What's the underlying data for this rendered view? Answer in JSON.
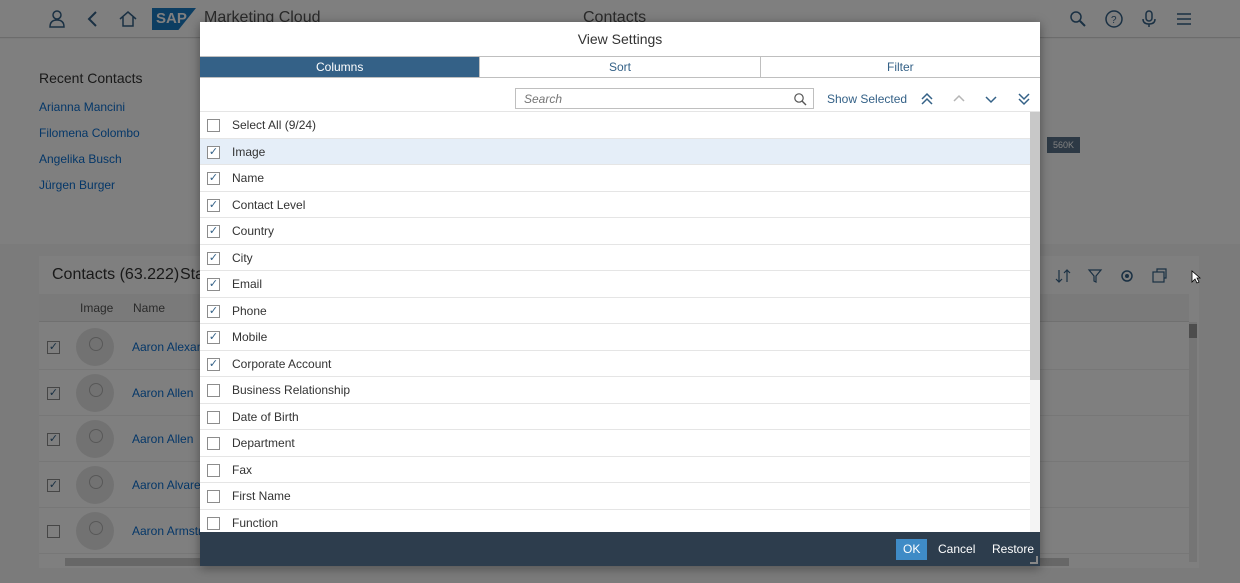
{
  "shell": {
    "logo_text": "SAP",
    "app_title": "Marketing Cloud",
    "center_title": "Contacts",
    "icons": [
      "user-icon",
      "back-icon",
      "home-icon",
      "search-icon",
      "help-icon",
      "microphone-icon",
      "menu-icon"
    ]
  },
  "recent_contacts": {
    "title": "Recent Contacts",
    "items": [
      "Arianna Mancini",
      "Filomena Colombo",
      "Angelika Busch",
      "Jürgen Burger"
    ],
    "badge": "560K"
  },
  "contacts_table": {
    "title": "Contacts (63.222)",
    "tab_partial": "Sta",
    "columns": [
      "Image",
      "Name"
    ],
    "rows": [
      {
        "name": "Aaron Alexan",
        "checked": true
      },
      {
        "name": "Aaron Allen",
        "checked": true
      },
      {
        "name": "Aaron Allen",
        "checked": true
      },
      {
        "name": "Aaron Alvarez",
        "checked": true
      },
      {
        "name": "Aaron Armstro",
        "checked": false
      }
    ]
  },
  "dialog": {
    "title": "View Settings",
    "tabs": [
      {
        "label": "Columns",
        "active": true
      },
      {
        "label": "Sort",
        "active": false
      },
      {
        "label": "Filter",
        "active": false
      }
    ],
    "search_placeholder": "Search",
    "show_selected_label": "Show Selected",
    "move_buttons": [
      "move-to-top-icon",
      "move-up-icon",
      "move-down-icon",
      "move-to-bottom-icon"
    ],
    "items": [
      {
        "label": "Select All (9/24)",
        "checked": false
      },
      {
        "label": "Image",
        "checked": true,
        "highlighted": true
      },
      {
        "label": "Name",
        "checked": true
      },
      {
        "label": "Contact Level",
        "checked": true
      },
      {
        "label": "Country",
        "checked": true
      },
      {
        "label": "City",
        "checked": true
      },
      {
        "label": "Email",
        "checked": true
      },
      {
        "label": "Phone",
        "checked": true
      },
      {
        "label": "Mobile",
        "checked": true
      },
      {
        "label": "Corporate Account",
        "checked": true
      },
      {
        "label": "Business Relationship",
        "checked": false
      },
      {
        "label": "Date of Birth",
        "checked": false
      },
      {
        "label": "Department",
        "checked": false
      },
      {
        "label": "Fax",
        "checked": false
      },
      {
        "label": "First Name",
        "checked": false
      },
      {
        "label": "Function",
        "checked": false
      }
    ],
    "footer": {
      "ok": "OK",
      "cancel": "Cancel",
      "restore": "Restore"
    }
  },
  "colors": {
    "accent": "#346187",
    "link": "#0a6ed1",
    "footer_bg": "#2d3d4d",
    "ok_button": "#3f8bc6",
    "highlight_row": "#e5eef8"
  }
}
